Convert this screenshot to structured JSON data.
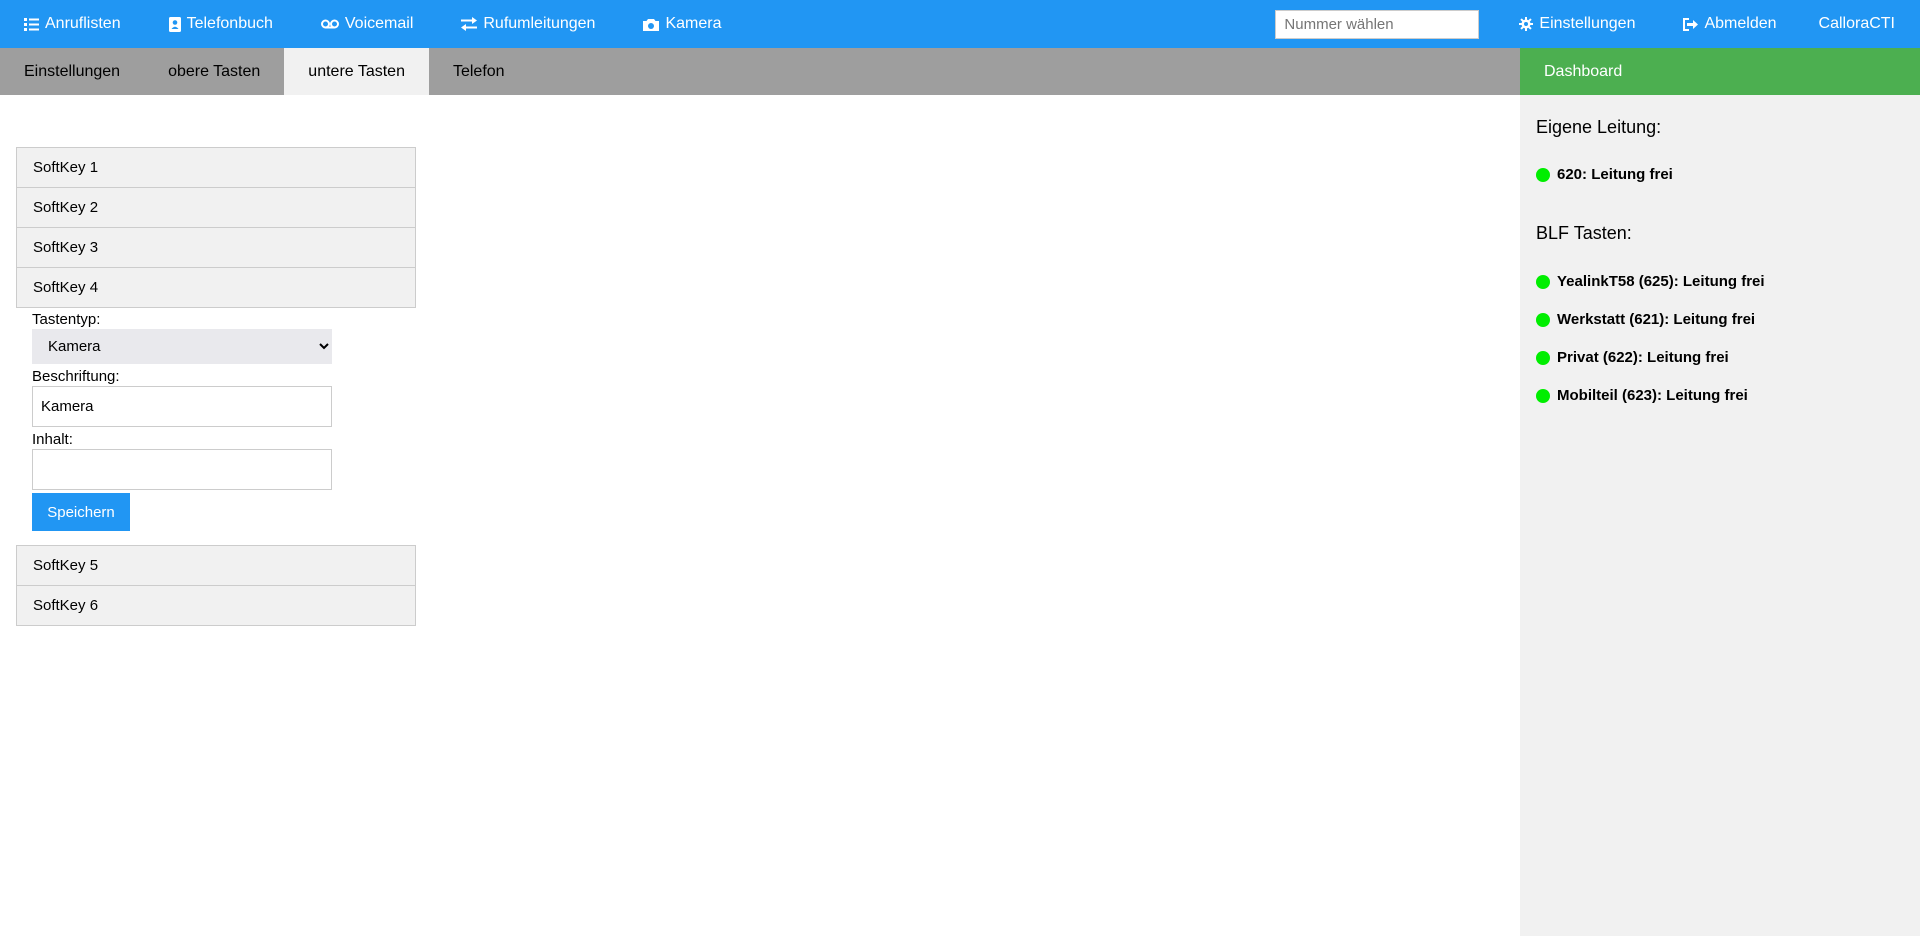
{
  "topbar": {
    "nav": [
      {
        "label": "Anruflisten",
        "icon": "list-icon"
      },
      {
        "label": "Telefonbuch",
        "icon": "address-book-icon"
      },
      {
        "label": "Voicemail",
        "icon": "voicemail-icon"
      },
      {
        "label": "Rufumleitungen",
        "icon": "forward-icon"
      },
      {
        "label": "Kamera",
        "icon": "camera-icon"
      }
    ],
    "search_placeholder": "Nummer wählen",
    "settings_label": "Einstellungen",
    "logout_label": "Abmelden",
    "brand": "CalloraCTI"
  },
  "subbar": {
    "tabs": [
      "Einstellungen",
      "obere Tasten",
      "untere Tasten",
      "Telefon"
    ],
    "active_tab": "untere Tasten"
  },
  "accordion": {
    "items": [
      "SoftKey 1",
      "SoftKey 2",
      "SoftKey 3",
      "SoftKey 4",
      "SoftKey 5",
      "SoftKey 6"
    ],
    "open_item": "SoftKey 4",
    "form": {
      "type_label": "Tastentyp:",
      "type_value": "Kamera",
      "caption_label": "Beschriftung:",
      "caption_value": "Kamera",
      "content_label": "Inhalt:",
      "content_value": "",
      "save_label": "Speichern"
    }
  },
  "sidebar": {
    "dashboard_label": "Dashboard",
    "own_line_title": "Eigene Leitung:",
    "own_lines": [
      "620: Leitung frei"
    ],
    "blf_title": "BLF Tasten:",
    "blf_lines": [
      "YealinkT58 (625): Leitung frei",
      "Werkstatt (621): Leitung frei",
      "Privat (622): Leitung frei",
      "Mobilteil (623): Leitung frei"
    ],
    "status_color": "#00ee00"
  },
  "colors": {
    "primary": "#2196f3",
    "dashboard": "#4caf50",
    "subbar": "#9e9e9e"
  }
}
